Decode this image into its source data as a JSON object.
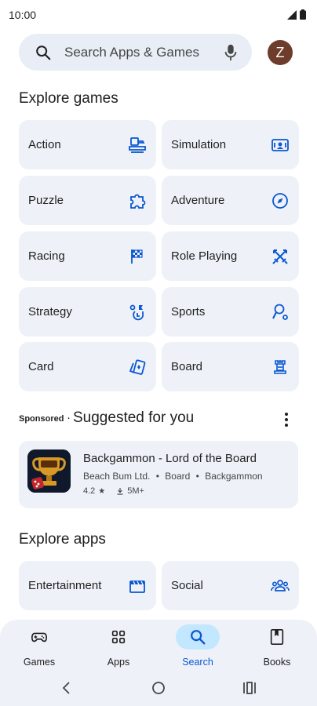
{
  "status": {
    "time": "10:00"
  },
  "search": {
    "placeholder": "Search Apps & Games",
    "avatar_letter": "Z"
  },
  "explore_games": {
    "title": "Explore games",
    "categories": [
      {
        "label": "Action",
        "icon": "controller-joystick-icon"
      },
      {
        "label": "Simulation",
        "icon": "simulation-icon"
      },
      {
        "label": "Puzzle",
        "icon": "puzzle-icon"
      },
      {
        "label": "Adventure",
        "icon": "compass-icon"
      },
      {
        "label": "Racing",
        "icon": "checkered-flag-icon"
      },
      {
        "label": "Role Playing",
        "icon": "crossed-swords-icon"
      },
      {
        "label": "Strategy",
        "icon": "strategy-icon"
      },
      {
        "label": "Sports",
        "icon": "sports-icon"
      },
      {
        "label": "Card",
        "icon": "cards-icon"
      },
      {
        "label": "Board",
        "icon": "rook-icon"
      }
    ]
  },
  "suggested": {
    "sponsored_label": "Sponsored",
    "separator": "·",
    "title": "Suggested for you",
    "app": {
      "name": "Backgammon - Lord of the Board",
      "developer": "Beach Bum Ltd.",
      "category": "Board",
      "subcategory": "Backgammon",
      "meta_separator": "•",
      "rating": "4.2",
      "rating_star": "★",
      "downloads": "5M+"
    }
  },
  "explore_apps": {
    "title": "Explore apps",
    "categories": [
      {
        "label": "Entertainment",
        "icon": "clapperboard-icon"
      },
      {
        "label": "Social",
        "icon": "people-icon"
      }
    ]
  },
  "bottom_nav": {
    "items": [
      {
        "label": "Games",
        "icon": "gamepad-icon",
        "active": false
      },
      {
        "label": "Apps",
        "icon": "apps-grid-icon",
        "active": false
      },
      {
        "label": "Search",
        "icon": "search-icon",
        "active": true
      },
      {
        "label": "Books",
        "icon": "book-icon",
        "active": false
      }
    ]
  },
  "colors": {
    "accent": "#0b57d0",
    "surface": "#eef2f8",
    "search_surface": "#e9eef6",
    "active_pill": "#c2e7ff",
    "avatar_bg": "#6d3c2b"
  }
}
